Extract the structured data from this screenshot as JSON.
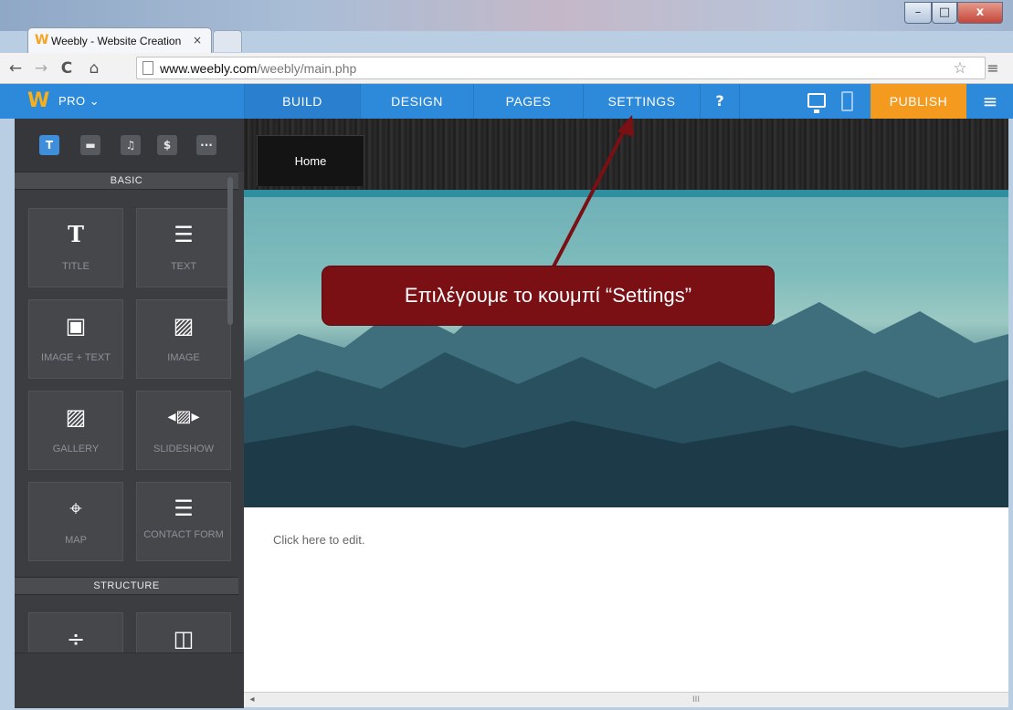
{
  "browser": {
    "tab_title": "Weebly - Website Creation",
    "tab_close": "×",
    "url_domain": "www.weebly.com",
    "url_path": "/weebly/main.php",
    "nav_back": "←",
    "nav_forward": "→",
    "nav_reload": "C",
    "nav_home": "⌂",
    "star": "☆",
    "menu": "≡",
    "win_min": "–",
    "win_max": "□",
    "win_close": "x"
  },
  "weebly_bar": {
    "logo": "W",
    "plan": "PRO ⌄",
    "tabs": [
      {
        "label": "BUILD"
      },
      {
        "label": "DESIGN"
      },
      {
        "label": "PAGES"
      },
      {
        "label": "SETTINGS"
      }
    ],
    "help": "?",
    "publish": "PUBLISH",
    "menu": "≡"
  },
  "sidebar": {
    "tool_tabs": [
      "T",
      "▬",
      "♫",
      "$",
      "···"
    ],
    "sections": [
      {
        "title": "BASIC"
      },
      {
        "title": "STRUCTURE"
      }
    ],
    "elements": [
      {
        "icon": "T",
        "label": "TITLE"
      },
      {
        "icon": "☰",
        "label": "TEXT"
      },
      {
        "icon": "▣",
        "label": "IMAGE + TEXT"
      },
      {
        "icon": "▨",
        "label": "IMAGE"
      },
      {
        "icon": "▨",
        "label": "GALLERY"
      },
      {
        "icon": "◂▨▸",
        "label": "SLIDESHOW"
      },
      {
        "icon": "⌖",
        "label": "MAP"
      },
      {
        "icon": "☰",
        "label": "CONTACT FORM"
      },
      {
        "icon": "÷",
        "label": ""
      },
      {
        "icon": "◫",
        "label": ""
      }
    ]
  },
  "canvas": {
    "home_tab": "Home",
    "edit_placeholder": "Click here to edit."
  },
  "hscroll": {
    "left": "◂",
    "grip": "III"
  },
  "annotation": {
    "text": "Επιλέγουμε το κουμπί “Settings”",
    "color": "#7a0f14"
  },
  "colors": {
    "weebly_blue": "#2d89d9",
    "publish_orange": "#f39a1f",
    "sidebar_bg": "#3b3d40"
  }
}
